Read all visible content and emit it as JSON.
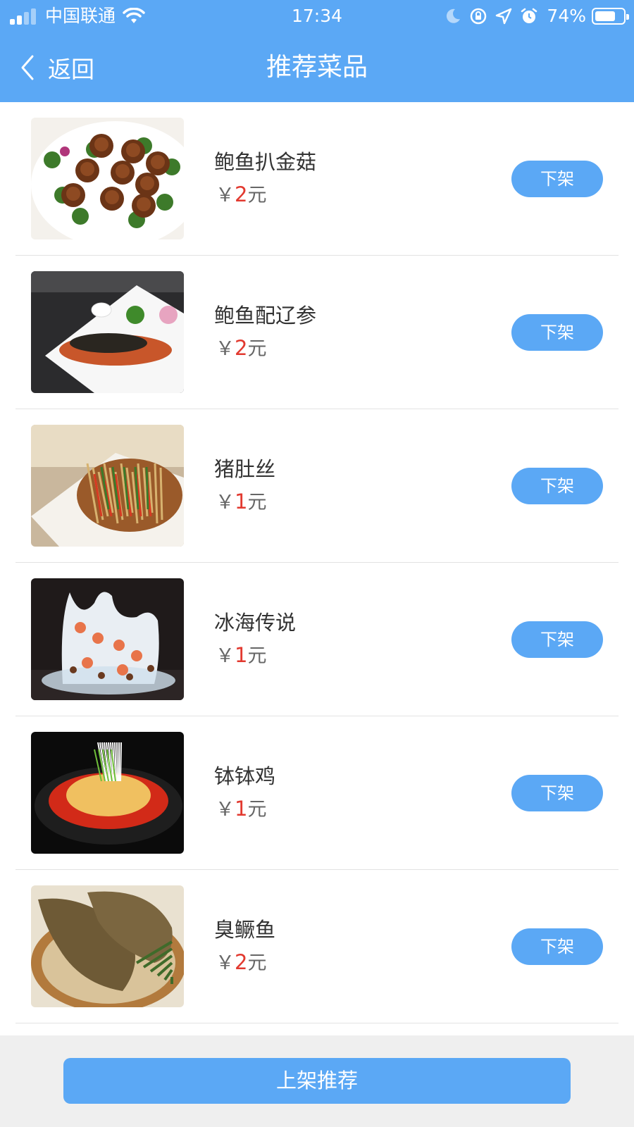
{
  "status_bar": {
    "carrier": "中国联通",
    "time": "17:34",
    "battery": "74%",
    "battery_level": 0.74
  },
  "header": {
    "back_label": "返回",
    "title": "推荐菜品"
  },
  "dishes": [
    {
      "name": "鲍鱼扒金菇",
      "currency": "￥",
      "price": "2",
      "unit": "元",
      "action": "下架",
      "image": "abalone-with-mushrooms-photo"
    },
    {
      "name": "鲍鱼配辽参",
      "currency": "￥",
      "price": "2",
      "unit": "元",
      "action": "下架",
      "image": "abalone-with-sea-cucumber-photo"
    },
    {
      "name": "猪肚丝",
      "currency": "￥",
      "price": "1",
      "unit": "元",
      "action": "下架",
      "image": "shredded-pork-tripe-photo"
    },
    {
      "name": "冰海传说",
      "currency": "￥",
      "price": "1",
      "unit": "元",
      "action": "下架",
      "image": "ice-sea-legend-photo"
    },
    {
      "name": "钵钵鸡",
      "currency": "￥",
      "price": "1",
      "unit": "元",
      "action": "下架",
      "image": "bobo-chicken-photo"
    },
    {
      "name": "臭鳜鱼",
      "currency": "￥",
      "price": "2",
      "unit": "元",
      "action": "下架",
      "image": "stinky-mandarin-fish-photo"
    }
  ],
  "footer": {
    "button_label": "上架推荐"
  },
  "colors": {
    "primary": "#5ba8f5",
    "price_red": "#e2392f",
    "text": "#333333",
    "footer_bg": "#efefef"
  }
}
